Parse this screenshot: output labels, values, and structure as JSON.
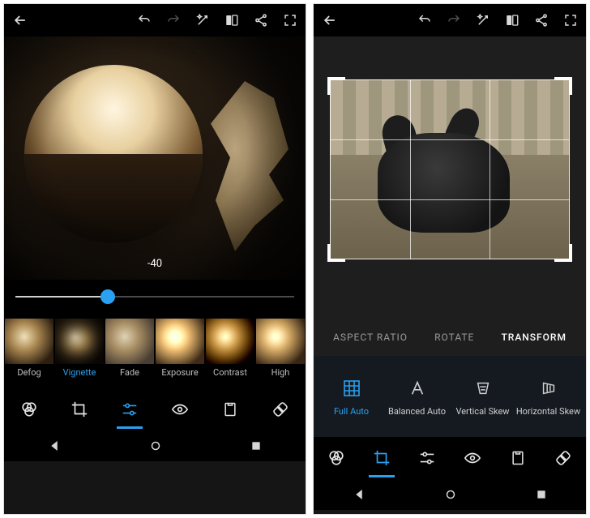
{
  "left": {
    "topbar": {
      "back": "back",
      "undo": "undo",
      "redo": "redo",
      "magic": "auto-enhance",
      "compare": "compare",
      "share": "share",
      "fullscreen": "fullscreen"
    },
    "adjust": {
      "value_text": "-40",
      "slider_percent": 33
    },
    "presets": [
      {
        "key": "defog",
        "label": "Defog"
      },
      {
        "key": "vignette",
        "label": "Vignette",
        "active": true
      },
      {
        "key": "fade",
        "label": "Fade"
      },
      {
        "key": "exposure",
        "label": "Exposure"
      },
      {
        "key": "contrast",
        "label": "Contrast"
      },
      {
        "key": "highlights",
        "label": "High"
      }
    ],
    "toolbar": {
      "looks": "looks",
      "crop": "crop",
      "adjust": "adjust",
      "redeye": "red-eye",
      "clipboard": "stickers",
      "heal": "heal"
    }
  },
  "right": {
    "topbar": {
      "back": "back",
      "undo": "undo",
      "redo": "redo",
      "magic": "auto-enhance",
      "compare": "compare",
      "share": "share",
      "fullscreen": "fullscreen"
    },
    "tabs": {
      "aspect": "ASPECT RATIO",
      "rotate": "ROTATE",
      "transform": "TRANSFORM",
      "active": "transform"
    },
    "transform_options": [
      {
        "key": "full-auto",
        "label": "Full Auto",
        "active": true
      },
      {
        "key": "balanced",
        "label": "Balanced Auto"
      },
      {
        "key": "vskew",
        "label": "Vertical Skew"
      },
      {
        "key": "hskew",
        "label": "Horizontal Skew"
      }
    ],
    "toolbar": {
      "looks": "looks",
      "crop": "crop",
      "adjust": "adjust",
      "redeye": "red-eye",
      "clipboard": "stickers",
      "heal": "heal"
    }
  },
  "nav": {
    "back": "back",
    "home": "home",
    "recents": "recents"
  }
}
